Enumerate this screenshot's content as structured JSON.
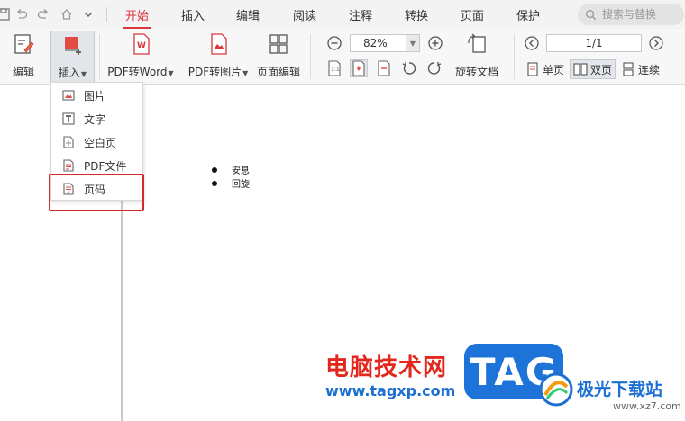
{
  "menu": {
    "tabs": [
      "开始",
      "插入",
      "编辑",
      "阅读",
      "注释",
      "转换",
      "页面",
      "保护"
    ],
    "active_tab": "开始",
    "search_placeholder": "搜索与替换"
  },
  "ribbon": {
    "edit_label": "编辑",
    "insert_label": "插入",
    "pdf_to_word_label": "PDF转Word",
    "pdf_to_image_label": "PDF转图片",
    "page_edit_label": "页面编辑",
    "zoom_value": "82%",
    "rotate_doc_label": "旋转文档",
    "page_indicator": "1/1",
    "single_page_label": "单页",
    "double_page_label": "双页",
    "continuous_label": "连续"
  },
  "insert_menu": {
    "items": [
      {
        "label": "图片",
        "icon": "image-icon"
      },
      {
        "label": "文字",
        "icon": "text-icon"
      },
      {
        "label": "空白页",
        "icon": "blank-page-icon"
      },
      {
        "label": "PDF文件",
        "icon": "pdf-file-icon"
      },
      {
        "label": "页码",
        "icon": "page-number-icon"
      }
    ],
    "highlighted": "页码"
  },
  "document": {
    "list_items": [
      "安息",
      "回旋"
    ]
  },
  "watermark": {
    "brand": "电脑技术网",
    "url": "www.tagxp.com",
    "tag": "TAG",
    "site_name": "极光下载站",
    "site_url": "www.xz7.com"
  },
  "colors": {
    "accent_red": "#d9363e",
    "highlight_border": "#d42a2a",
    "watermark_blue": "#1e73d8"
  }
}
